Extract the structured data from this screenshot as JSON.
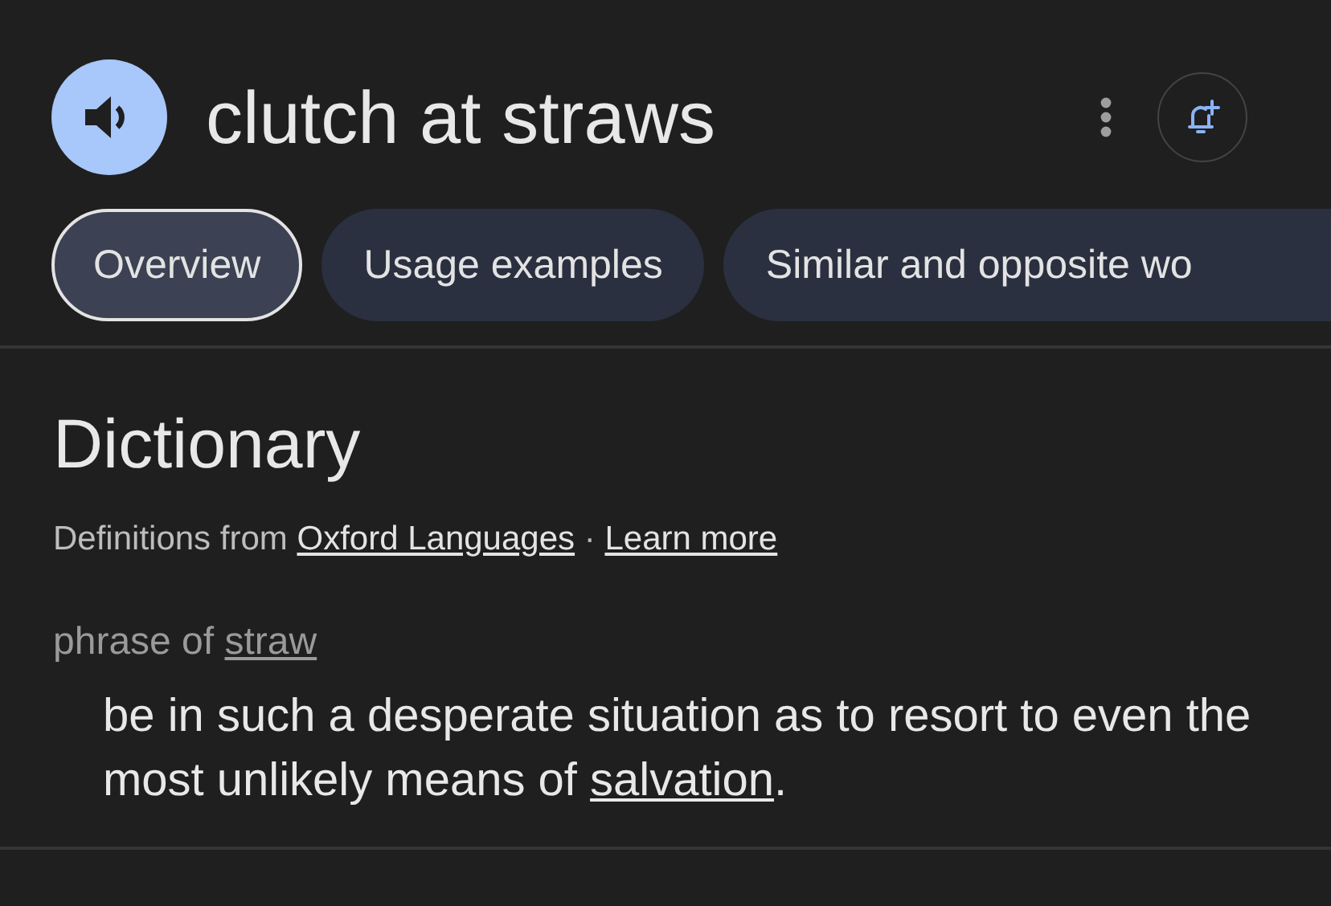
{
  "header": {
    "title": "clutch at straws"
  },
  "tabs": [
    {
      "label": "Overview",
      "selected": true
    },
    {
      "label": "Usage examples",
      "selected": false
    },
    {
      "label": "Similar and opposite wo",
      "selected": false
    }
  ],
  "dictionary": {
    "heading": "Dictionary",
    "source_prefix": "Definitions from",
    "source_link": "Oxford Languages",
    "separator": "·",
    "learn_more": "Learn more",
    "phrase_prefix": "phrase of",
    "phrase_link": "straw",
    "definition": {
      "text_before": "be in such a desperate situation as to resort to even the most unlikely means of",
      "link": "salvation",
      "text_after": "."
    }
  }
}
